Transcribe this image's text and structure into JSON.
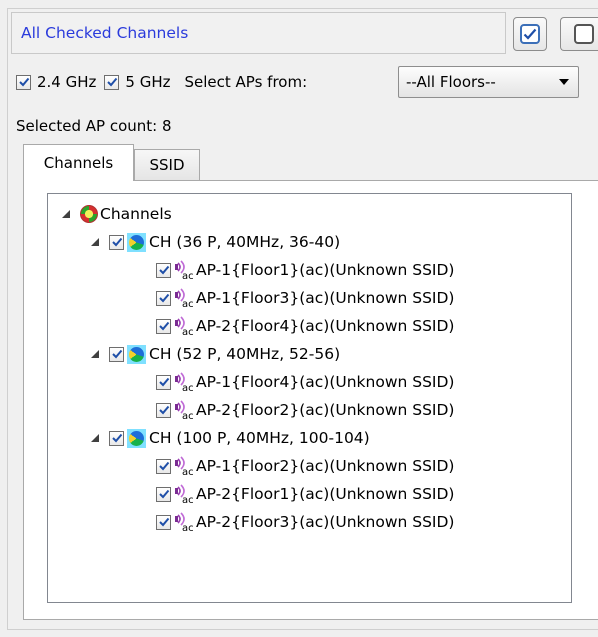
{
  "title_field": "All Checked Channels",
  "bands": [
    {
      "label": "2.4 GHz",
      "checked": true
    },
    {
      "label": "5 GHz",
      "checked": true
    }
  ],
  "select_aps_label": "Select APs from:",
  "floor_select": {
    "value": "--All Floors--"
  },
  "count_label": "Selected AP count: 8",
  "tabs": [
    {
      "label": "Channels",
      "active": true
    },
    {
      "label": "SSID",
      "active": false
    }
  ],
  "tree": {
    "root": "Channels",
    "channels": [
      {
        "label": "CH (36 P, 40MHz, 36-40)",
        "aps": [
          "AP-1{Floor1}(ac)(Unknown SSID)",
          "AP-1{Floor3}(ac)(Unknown SSID)",
          "AP-2{Floor4}(ac)(Unknown SSID)"
        ]
      },
      {
        "label": "CH (52 P, 40MHz, 52-56)",
        "aps": [
          "AP-1{Floor4}(ac)(Unknown SSID)",
          "AP-2{Floor2}(ac)(Unknown SSID)"
        ]
      },
      {
        "label": "CH (100 P, 40MHz, 100-104)",
        "aps": [
          "AP-1{Floor2}(ac)(Unknown SSID)",
          "AP-2{Floor1}(ac)(Unknown SSID)",
          "AP-2{Floor3}(ac)(Unknown SSID)"
        ]
      }
    ]
  },
  "icons": {
    "ap": "wireless-ac-icon",
    "channel": "channel-icon",
    "root": "channels-root-icon"
  },
  "colors": {
    "title_text": "#2b3bdc",
    "check_mark": "#1f4fa8"
  }
}
